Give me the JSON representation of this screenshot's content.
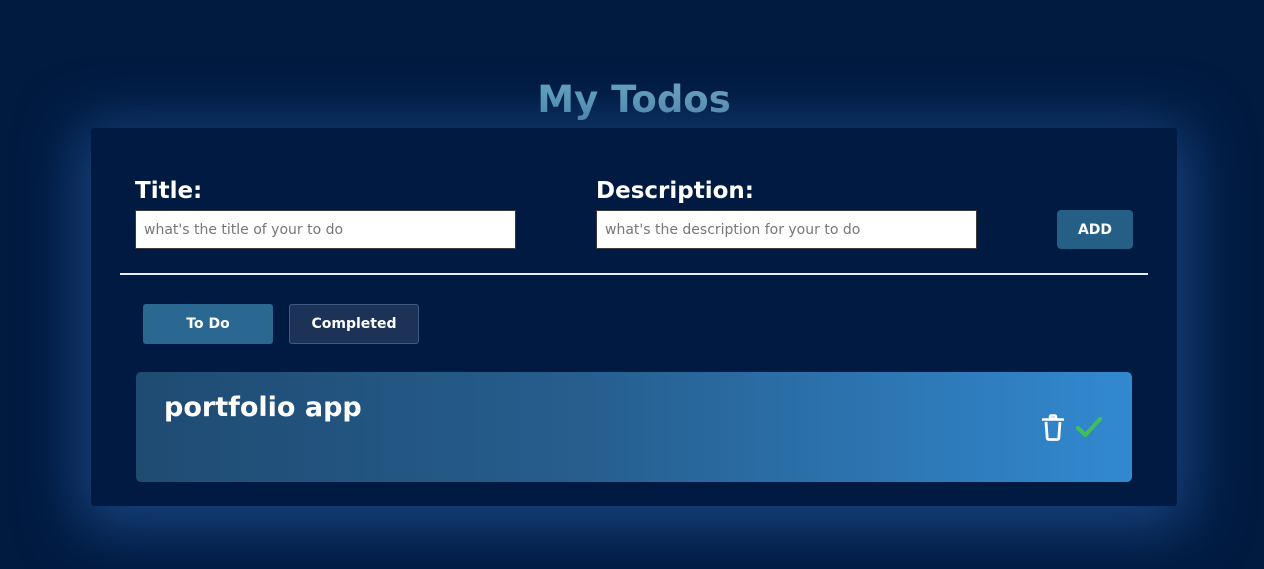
{
  "header": {
    "title": "My Todos"
  },
  "form": {
    "title_label": "Title:",
    "title_placeholder": "what's the title of your to do",
    "title_value": "",
    "description_label": "Description:",
    "description_placeholder": "what's the description for your to do",
    "description_value": "",
    "add_label": "ADD"
  },
  "tabs": [
    {
      "label": "To Do",
      "active": true
    },
    {
      "label": "Completed",
      "active": false
    }
  ],
  "todos": [
    {
      "title": "portfolio app",
      "actions": [
        {
          "icon": "trash-icon",
          "color": "#ffffff"
        },
        {
          "icon": "check-icon",
          "color": "#3fbf5a"
        }
      ]
    }
  ],
  "colors": {
    "background": "#001a40",
    "accent": "#255f86",
    "check": "#3fbf5a"
  }
}
